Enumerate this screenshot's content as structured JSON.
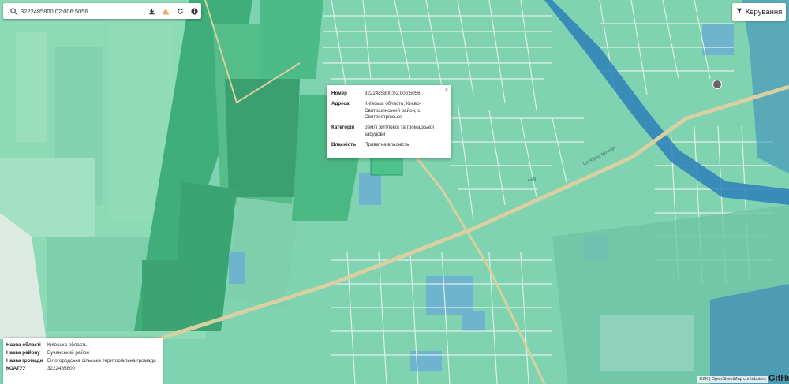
{
  "search": {
    "value": "3222485800:02:006:5056"
  },
  "toolbar": {
    "download_icon": "download-icon",
    "warning_icon": "warning-icon",
    "refresh_icon": "refresh-icon",
    "info_icon": "info-icon",
    "search_icon": "search-icon"
  },
  "controls": {
    "label": "Керування",
    "icon": "filter-icon"
  },
  "popup": {
    "rows": [
      {
        "key": "Номер",
        "value": "3222485800:02:006:5056"
      },
      {
        "key": "Адреса",
        "value": "Київська область, Києво-Святошинський район, с. Святопетрівське"
      },
      {
        "key": "Категорія",
        "value": "Землі житлової та громадської забудови"
      },
      {
        "key": "Власність",
        "value": "Приватна власність"
      }
    ]
  },
  "info_panel": {
    "rows": [
      {
        "key": "Назва області",
        "value": "Київська область"
      },
      {
        "key": "Назва району",
        "value": "Бучанський район"
      },
      {
        "key": "Назва громади",
        "value": "Білогородська сільська територіальна громада"
      },
      {
        "key": "КОАТУУ",
        "value": "3222485800"
      }
    ]
  },
  "map_labels": {
    "street": "Соборна вулиця",
    "highway": "Р69"
  },
  "attribution": {
    "text": "DZK | OpenStreetMap contributors",
    "github": "GitHub"
  },
  "colors": {
    "parcel_base": "#7fd3b0",
    "parcel_dark": "#3fae7a",
    "parcel_blue": "#6fb4cf",
    "road": "#d8d0a0",
    "water": "#2d7fb8"
  }
}
